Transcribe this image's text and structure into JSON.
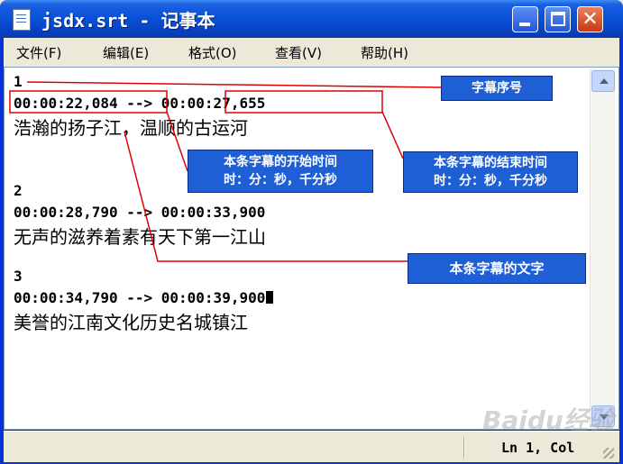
{
  "window": {
    "title": "jsdx.srt - 记事本"
  },
  "menu": {
    "items": [
      "文件(F)",
      "编辑(E)",
      "格式(O)",
      "查看(V)",
      "帮助(H)"
    ]
  },
  "document": {
    "lines": [
      "1",
      "00:00:22,084 --> 00:00:27,655",
      "浩瀚的扬子江，温顺的古运河",
      "2",
      "00:00:28,790 --> 00:00:33,900",
      "无声的滋养着素有天下第一江山",
      "3",
      "00:00:34,790 --> 00:00:39,900",
      "美誉的江南文化历史名城镇江"
    ]
  },
  "annotations": {
    "sequence_label": "字幕序号",
    "start_time_line1": "本条字幕的开始时间",
    "start_time_line2": "时：分：秒，千分秒",
    "end_time_line1": "本条字幕的结束时间",
    "end_time_line2": "时：分：秒，千分秒",
    "text_label": "本条字幕的文字",
    "color": "#1e5fd6",
    "line_color": "#e00000"
  },
  "status": {
    "position": "Ln 1, Col"
  },
  "watermark": {
    "text": "Baidu经验"
  }
}
